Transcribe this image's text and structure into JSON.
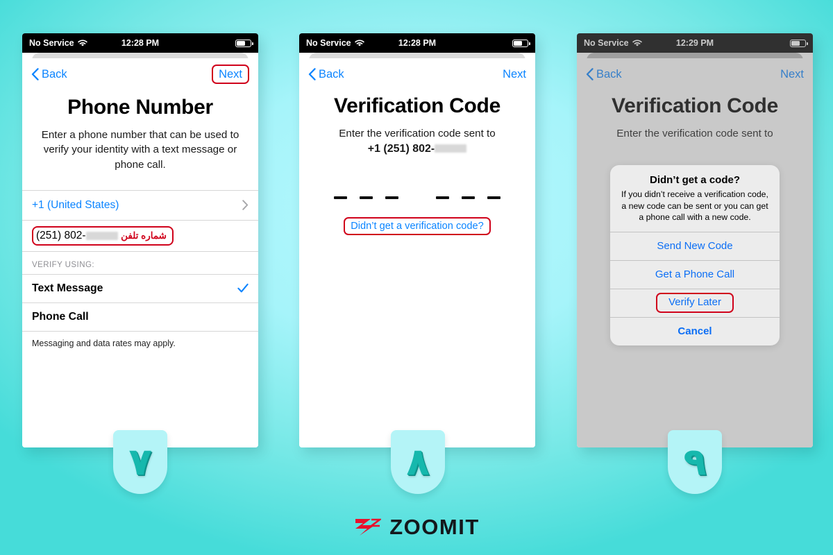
{
  "background": {
    "accent_light": "#b6f8fd",
    "accent_dark": "#46dcd9"
  },
  "annotation_color": "#d0021b",
  "link_color": "#0b84ff",
  "phones": [
    {
      "id": "phone-number-screen",
      "status": {
        "carrier": "No Service",
        "time": "12:28 PM",
        "wifi_icon": "wifi-icon",
        "battery_icon": "battery-icon"
      },
      "nav": {
        "back_label": "Back",
        "next_label": "Next",
        "back_icon": "chevron-left-icon",
        "next_highlighted": true
      },
      "title": "Phone Number",
      "subtitle": "Enter a phone number that can be used to verify your identity with a text message or phone call.",
      "country_row": {
        "label": "+1 (United States)",
        "chevron_icon": "chevron-right-icon"
      },
      "phone_field": {
        "value": "(251) 802-",
        "redacted": true,
        "annotation_fa": "شماره تلفن",
        "highlighted": true
      },
      "section_header": "VERIFY USING:",
      "options": [
        {
          "label": "Text Message",
          "selected": true,
          "check_icon": "checkmark-icon"
        },
        {
          "label": "Phone Call",
          "selected": false
        }
      ],
      "footnote": "Messaging and data rates may apply.",
      "badge": "۷"
    },
    {
      "id": "verification-code-screen",
      "status": {
        "carrier": "No Service",
        "time": "12:28 PM",
        "wifi_icon": "wifi-icon",
        "battery_icon": "battery-icon"
      },
      "nav": {
        "back_label": "Back",
        "next_label": "Next",
        "back_icon": "chevron-left-icon",
        "next_highlighted": false
      },
      "title": "Verification Code",
      "subtitle": "Enter the verification code sent to",
      "phone_display": "+1 (251) 802-",
      "code_slots": 6,
      "help_link": "Didn’t get a verification code?",
      "help_highlighted": true,
      "badge": "۸"
    },
    {
      "id": "didnt-get-code-alert-screen",
      "status": {
        "carrier": "No Service",
        "time": "12:29 PM",
        "wifi_icon": "wifi-icon",
        "battery_icon": "battery-icon"
      },
      "nav": {
        "back_label": "Back",
        "next_label": "Next",
        "back_icon": "chevron-left-icon",
        "next_highlighted": false
      },
      "title": "Verification Code",
      "subtitle": "Enter the verification code sent to",
      "dimmed": true,
      "alert": {
        "title": "Didn’t get a code?",
        "message": "If you didn’t receive a verification code, a new code can be sent or you can get a phone call with a new code.",
        "buttons": [
          {
            "label": "Send New Code",
            "bold": false,
            "highlighted": false
          },
          {
            "label": "Get a Phone Call",
            "bold": false,
            "highlighted": false
          },
          {
            "label": "Verify Later",
            "bold": false,
            "highlighted": true
          },
          {
            "label": "Cancel",
            "bold": true,
            "highlighted": false
          }
        ]
      },
      "badge": "۹"
    }
  ],
  "footer": {
    "brand": "ZOOMIT",
    "mark_icon": "zoomit-z-mark-icon",
    "mark_color": "#e8112d"
  }
}
